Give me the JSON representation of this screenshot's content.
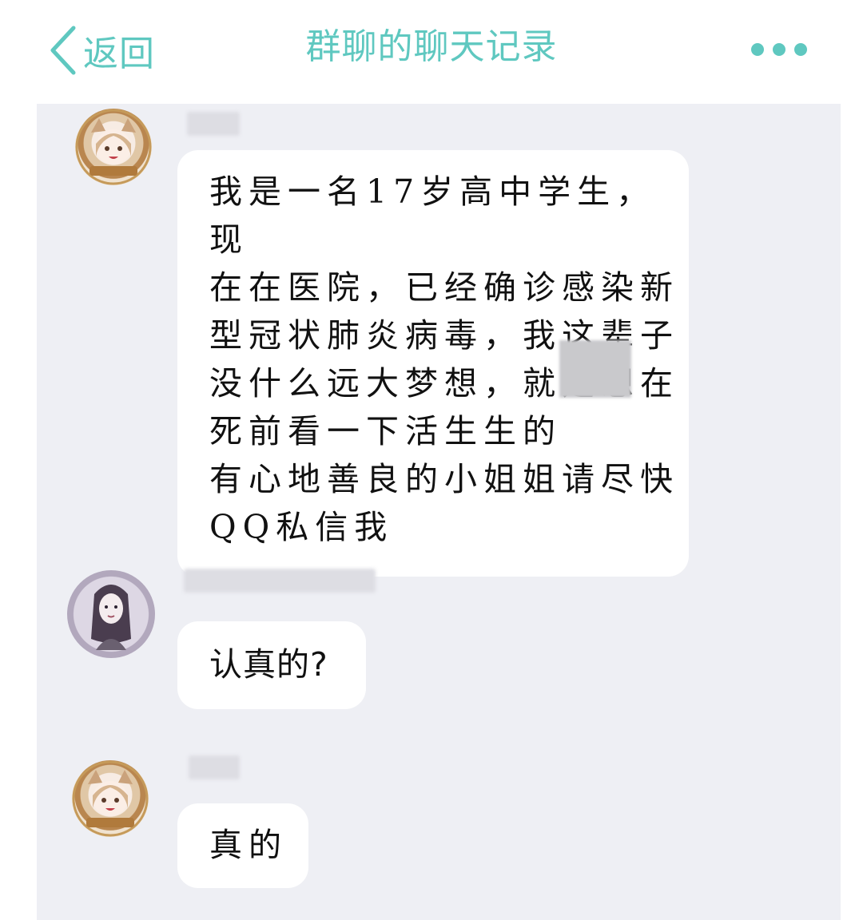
{
  "header": {
    "back_label": "返回",
    "title": "群聊的聊天记录",
    "more_icon": "more-dots-icon"
  },
  "colors": {
    "accent": "#5fc8c0",
    "chat_background": "#eeeff4",
    "bubble": "#ffffff"
  },
  "messages": [
    {
      "avatar": "anime-cat-girl-avatar",
      "text": "我是一名17岁高中学生，现\n在在医院，已经确诊感染新\n型冠状肺炎病毒，我这辈子\n没什么远大梦想，就是想在\n死前看一下活生生的\n有心地善良的小姐姐请尽快\nQQ私信我"
    },
    {
      "avatar": "anime-girl-avatar",
      "text": "认真的?"
    },
    {
      "avatar": "anime-cat-girl-avatar",
      "text": "真的"
    }
  ]
}
